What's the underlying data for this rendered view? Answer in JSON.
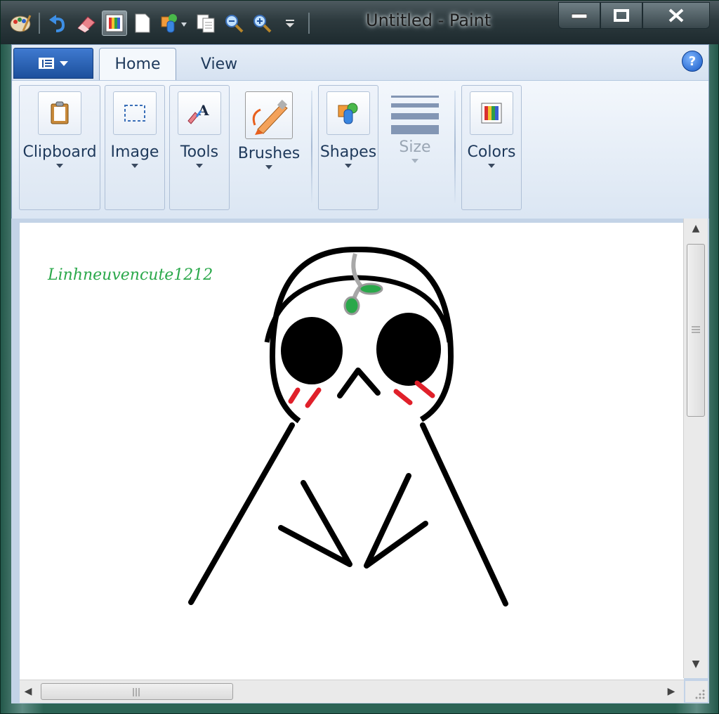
{
  "window": {
    "title": "Untitled - Paint"
  },
  "quick_access": [
    {
      "name": "paint-app-icon"
    },
    {
      "name": "undo-icon"
    },
    {
      "name": "eraser-icon"
    },
    {
      "name": "color-picker-icon"
    },
    {
      "name": "new-file-icon"
    },
    {
      "name": "shapes-tool-icon"
    },
    {
      "name": "copy-icon"
    },
    {
      "name": "zoom-out-icon"
    },
    {
      "name": "zoom-in-icon"
    },
    {
      "name": "customize-toolbar-icon"
    }
  ],
  "ribbon": {
    "tabs": [
      {
        "label": "Home"
      },
      {
        "label": "View"
      }
    ],
    "groups": [
      {
        "label": "Clipboard",
        "icon": "clipboard-icon"
      },
      {
        "label": "Image",
        "icon": "select-icon"
      },
      {
        "label": "Tools",
        "icon": "tools-icon"
      },
      {
        "label": "Brushes",
        "icon": "brush-icon"
      },
      {
        "label": "Shapes",
        "icon": "shapes-icon"
      },
      {
        "label": "Size",
        "icon": "size-icon"
      },
      {
        "label": "Colors",
        "icon": "colors-icon"
      }
    ]
  },
  "canvas": {
    "signature_text": "Linhneuvencute1212"
  },
  "colors": {
    "ribbon_bg": "#dbe6f4",
    "accent": "#1c4f9c",
    "drawing_black": "#000000",
    "blush_red": "#e0202a",
    "leaf_green": "#2aa84a"
  }
}
